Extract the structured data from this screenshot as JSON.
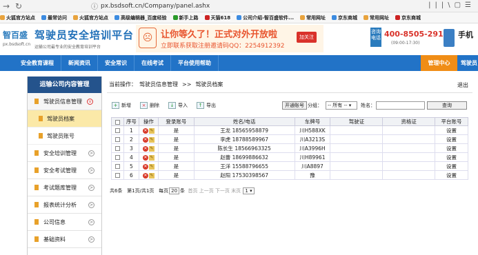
{
  "browser": {
    "url": "px.bsdsoft.cn/Company/panel.ashx"
  },
  "bookmarks": [
    "火狐官方站点",
    "最常访问",
    "火狐官方站点",
    "高级编辑器_百度经验",
    "新手上路",
    "天猫618",
    "公司介绍-智百盛软件...",
    "常用网址",
    "京东商城",
    "常用网址",
    "京东商城"
  ],
  "header": {
    "logo": "智百盛",
    "logo_sub": "px.bsdsoft.cn",
    "title": "驾驶员安全培训平台",
    "subtitle": "运输公司最专业的安全教育培训平台",
    "promo_line1": "让你等久了！正式对外开放啦",
    "promo_line2": "立即联系获取注册邀请码QQ：2254912392",
    "fav": "加关注",
    "phone_label": "咨询电话",
    "phone": "400-8505-291",
    "hours": "(09:00-17:30)",
    "mobile": "手机"
  },
  "nav": {
    "items": [
      "安全教育课程",
      "新闻资讯",
      "安全常识",
      "在线考试",
      "平台使用帮助"
    ],
    "center": "管理中心",
    "driver": "驾驶员"
  },
  "sidebar": {
    "title": "运输公司内容管理",
    "group_open": "驾驶员信息管理",
    "subs": [
      "驾驶员档案",
      "驾驶员账号"
    ],
    "groups": [
      "安全培训管理",
      "安全考试管理",
      "考试题库管理",
      "报表统计分析",
      "公司信息",
      "基础资料"
    ]
  },
  "content": {
    "crumb_label": "当前操作：",
    "crumb_a": "驾驶员信息管理",
    "crumb_sep": ">>",
    "crumb_b": "驾驶员档案",
    "logout": "退出",
    "toolbar": {
      "add": "新增",
      "del": "删除",
      "imp": "导入",
      "exp": "导出",
      "open": "开通账号",
      "group": "分组：",
      "group_sel": "-- 所有 --",
      "name": "姓名：",
      "query": "查询"
    },
    "columns": [
      "序号",
      "操作",
      "登录账号",
      "姓名/电话",
      "车牌号",
      "驾驶证",
      "资格证",
      "平台账号"
    ],
    "rows": [
      {
        "no": "1",
        "acct": "是",
        "name": "王龙 18565958879",
        "plate": "川H588XK",
        "lic": "",
        "qual": "",
        "plat": "设置"
      },
      {
        "no": "2",
        "acct": "是",
        "name": "李虎 18788589967",
        "plate": "川A3213S",
        "lic": "",
        "qual": "",
        "plat": "设置"
      },
      {
        "no": "3",
        "acct": "是",
        "name": "陈长生 18566963325",
        "plate": "川A3996H",
        "lic": "",
        "qual": "",
        "plat": "设置"
      },
      {
        "no": "4",
        "acct": "是",
        "name": "赵蕾 18699886632",
        "plate": "川H89961",
        "lic": "",
        "qual": "",
        "plat": "设置"
      },
      {
        "no": "5",
        "acct": "是",
        "name": "王洋 15588796655",
        "plate": "川A8897",
        "lic": "",
        "qual": "",
        "plat": "设置"
      },
      {
        "no": "6",
        "acct": "是",
        "name": "赵阳 17530398567",
        "plate": "豫",
        "lic": "",
        "qual": "",
        "plat": "设置"
      }
    ],
    "pager": {
      "total": "共6条",
      "page": "第1页/共1页",
      "per_pre": "每页",
      "per": "20",
      "per_post": "条",
      "first": "首页",
      "prev": "上一页",
      "next": "下一页",
      "last": "末页",
      "jump": "1"
    }
  }
}
